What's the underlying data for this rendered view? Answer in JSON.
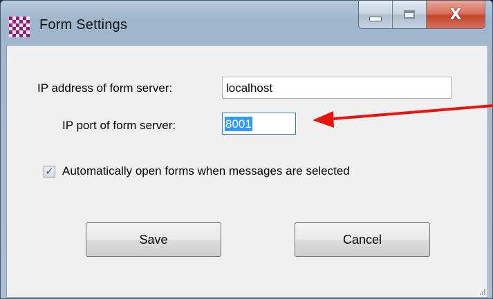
{
  "window": {
    "title": "Form Settings",
    "caption": {
      "minimize": "minimize-icon",
      "maximize": "maximize-icon",
      "close": "X"
    }
  },
  "form": {
    "ip_address_label": "IP address of form server:",
    "ip_address_value": "localhost",
    "ip_port_label": "IP port of form server:",
    "ip_port_value": "8001",
    "auto_open_label": "Automatically open forms when messages are selected",
    "auto_open_checked": true,
    "save_label": "Save",
    "cancel_label": "Cancel"
  },
  "annotation": {
    "arrow_color": "#e8140c",
    "arrow_icon": "left-arrow-icon"
  },
  "colors": {
    "selection": "#3399ff",
    "close_button": "#c4442b"
  }
}
